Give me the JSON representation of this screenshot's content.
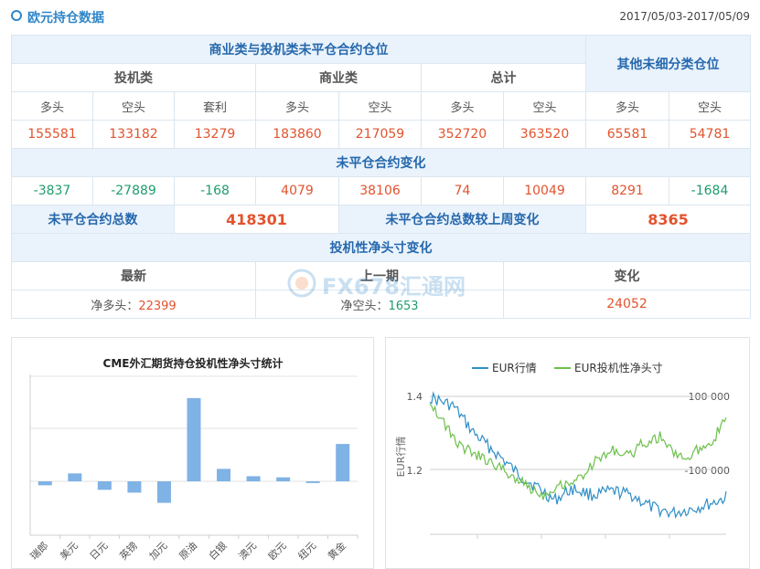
{
  "header": {
    "title": "欧元持仓数据",
    "date_range": "2017/05/03-2017/05/09"
  },
  "table": {
    "group_title": "商业类与投机类未平仓合约仓位",
    "other_title": "其他未细分类仓位",
    "cat_spec": "投机类",
    "cat_comm": "商业类",
    "cat_total": "总计",
    "col_long": "多头",
    "col_short": "空头",
    "col_spread": "套利",
    "values": [
      "155581",
      "133182",
      "13279",
      "183860",
      "217059",
      "352720",
      "363520",
      "65581",
      "54781"
    ],
    "change_title": "未平仓合约变化",
    "changes": [
      "-3837",
      "-27889",
      "-168",
      "4079",
      "38106",
      "74",
      "10049",
      "8291",
      "-1684"
    ],
    "oi_total_label": "未平仓合约总数",
    "oi_total_value": "418301",
    "oi_change_label": "未平仓合约总数较上周变化",
    "oi_change_value": "8365",
    "net_title": "投机性净头寸变化",
    "net_latest_label": "最新",
    "net_prev_label": "上一期",
    "net_change_label": "变化",
    "net_latest_prefix": "净多头：",
    "net_latest_value": "22399",
    "net_prev_prefix": "净空头：",
    "net_prev_value": "1653",
    "net_change_value": "24052"
  },
  "watermark": {
    "text": "FX678汇通网"
  },
  "chart_data": [
    {
      "type": "bar",
      "title": "CME外汇期货持仓投机性净头寸统计",
      "categories": [
        "瑞郎",
        "美元",
        "日元",
        "英镑",
        "加元",
        "原油",
        "白银",
        "澳元",
        "欧元",
        "纽元",
        "黄金"
      ],
      "values": [
        -0.07,
        0.14,
        -0.15,
        -0.2,
        -0.38,
        1.47,
        0.22,
        0.09,
        0.07,
        -0.03,
        0.66
      ],
      "grid": true
    },
    {
      "type": "line",
      "legend": [
        "EUR行情",
        "EUR投机性净头寸"
      ],
      "ylabel": "EUR行情",
      "y_ticks_left": [
        "1.4",
        "1.2"
      ],
      "y_ticks_right": [
        "100 000",
        "-100 000"
      ],
      "colors": {
        "eur": "#2f8fc7",
        "net": "#6cc04a"
      }
    }
  ]
}
